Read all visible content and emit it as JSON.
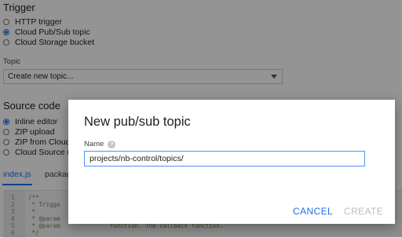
{
  "trigger": {
    "title": "Trigger",
    "options": [
      {
        "label": "HTTP trigger",
        "checked": false
      },
      {
        "label": "Cloud Pub/Sub topic",
        "checked": true
      },
      {
        "label": "Cloud Storage bucket",
        "checked": false
      }
    ]
  },
  "topic": {
    "label": "Topic",
    "selected": "Create new topic..."
  },
  "source": {
    "title": "Source code",
    "options": [
      {
        "label": "Inline editor",
        "checked": true
      },
      {
        "label": "ZIP upload",
        "checked": false
      },
      {
        "label": "ZIP from Cloud",
        "checked": false
      },
      {
        "label": "Cloud Source re",
        "checked": false
      }
    ]
  },
  "tabs": [
    "index.js",
    "packag"
  ],
  "editor": {
    "line_numbers": [
      "1",
      "2",
      "3",
      "4",
      "5",
      "6"
    ],
    "code_lines": [
      "/**",
      " * Trigge",
      " *",
      " * @param",
      " * @param              function. The callback function.",
      " */"
    ]
  },
  "dialog": {
    "title": "New pub/sub topic",
    "name_label": "Name",
    "name_value": "projects/nb-control/topics/",
    "cancel_label": "CANCEL",
    "create_label": "CREATE"
  },
  "colors": {
    "accent": "#1a73e8",
    "disabled": "#bdbdbd",
    "overlay": "rgba(0,0,0,0.42)"
  }
}
